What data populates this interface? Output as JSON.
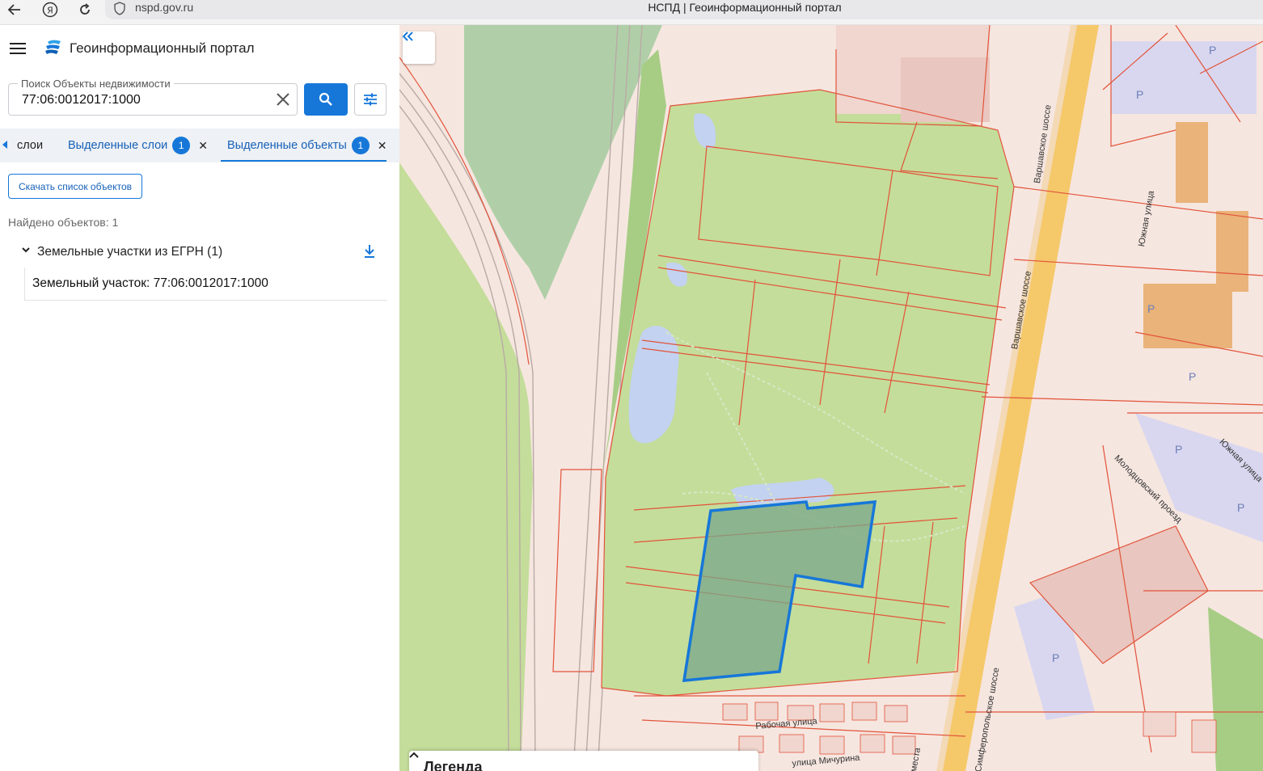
{
  "browser": {
    "url": "nspd.gov.ru",
    "page_title": "НСПД | Геоинформационный портал",
    "icons": [
      "back-icon",
      "yandex-icon",
      "reload-icon",
      "shield-icon"
    ]
  },
  "header": {
    "app_title": "Геоинформационный портал"
  },
  "search": {
    "label": "Поиск Объекты недвижимости",
    "value": "77:06:0012017:1000"
  },
  "tabs": [
    {
      "label": "слои"
    },
    {
      "label": "Выделенные слои",
      "count": "1"
    },
    {
      "label": "Выделенные объекты",
      "count": "1"
    }
  ],
  "actions": {
    "download_list": "Скачать список объектов"
  },
  "results": {
    "found_text": "Найдено объектов: 1",
    "group_label": "Земельные участки из ЕГРН (1)",
    "items": [
      {
        "label": "Земельный участок: 77:06:0012017:1000"
      }
    ]
  },
  "map": {
    "streets": [
      "Варшавское шоссе",
      "Варшавское шоссе",
      "Южная улица",
      "Южная улица",
      "Молодцовский проезд",
      "Рабочая улица",
      "улица Мичурина",
      "Симферопольское шоссе",
      "места"
    ],
    "parking_label": "P",
    "legend_title": "Легенда",
    "colors": {
      "background": "#f6e6e0",
      "park": "#c4dd9a",
      "water": "#c3d2f0",
      "parcel_border": "#e2533a",
      "selected_border": "#1677d9",
      "selected_fill": "#7aa58a",
      "road": "#f5c86a"
    }
  }
}
